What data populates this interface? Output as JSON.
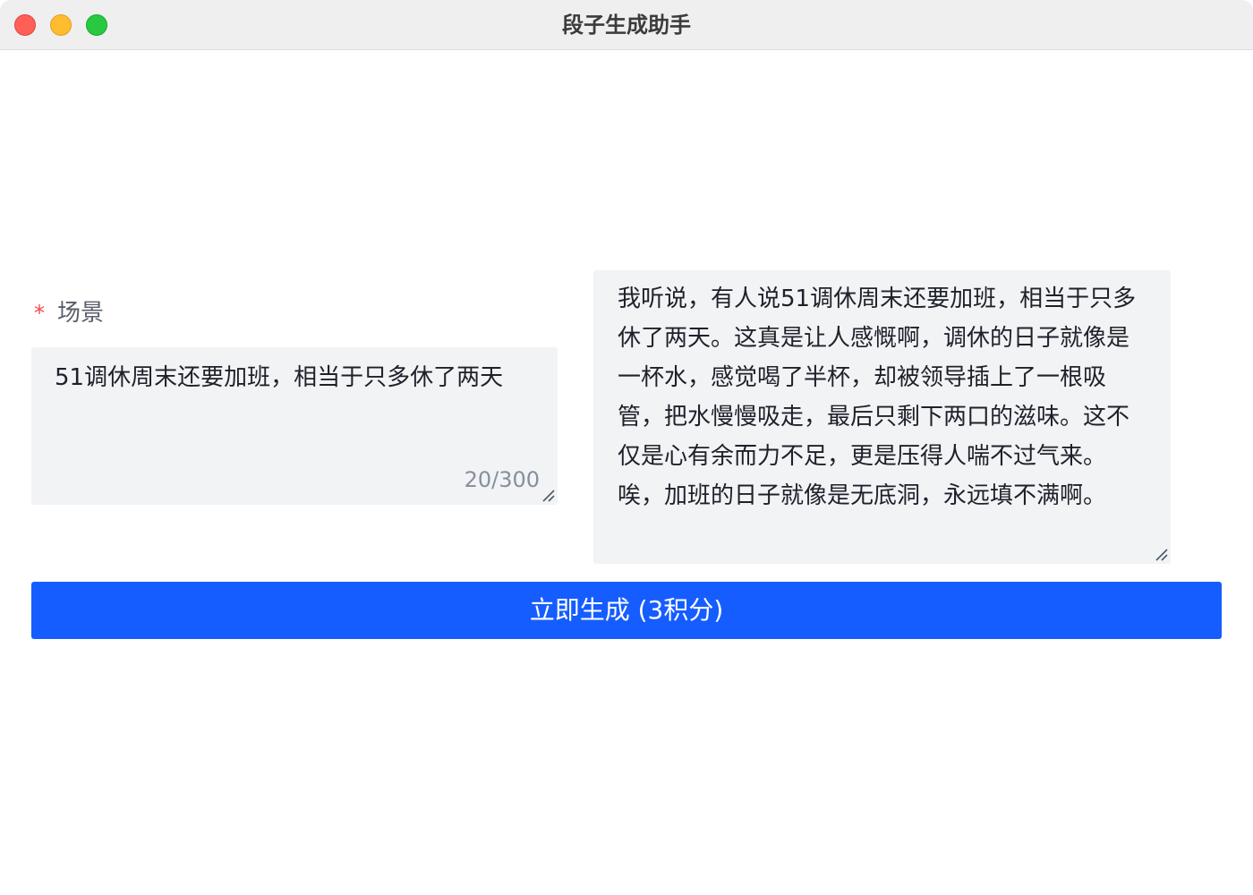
{
  "window": {
    "title": "段子生成助手"
  },
  "form": {
    "required_mark": "*",
    "scene_label": "场景",
    "scene_value": "51调休周末还要加班，相当于只多休了两天",
    "char_count": "20/300"
  },
  "output": {
    "text": "我听说，有人说51调休周末还要加班，相当于只多休了两天。这真是让人感慨啊，调休的日子就像是一杯水，感觉喝了半杯，却被领导插上了一根吸管，把水慢慢吸走，最后只剩下两口的滋味。这不仅是心有余而力不足，更是压得人喘不过气来。唉，加班的日子就像是无底洞，永远填不满啊。"
  },
  "actions": {
    "generate_label": "立即生成 (3积分)"
  },
  "colors": {
    "primary": "#165dff",
    "required": "#f5484a",
    "field_bg": "#f2f3f5"
  }
}
